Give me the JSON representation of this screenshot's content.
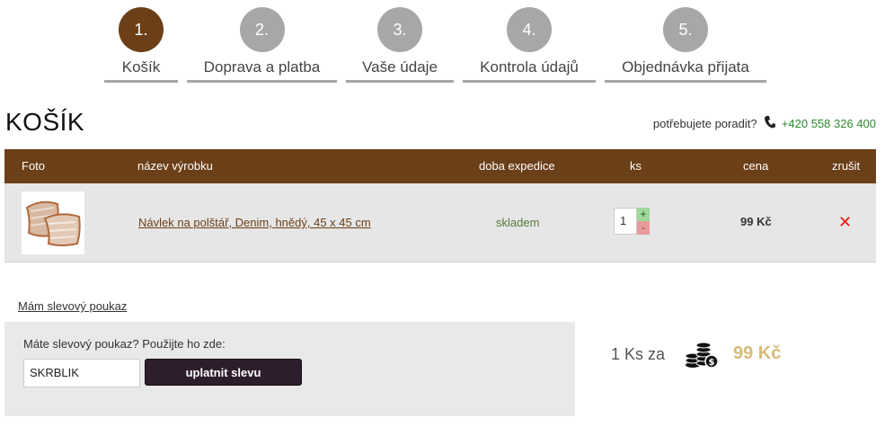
{
  "steps": [
    {
      "number": "1.",
      "label": "Košík",
      "active": true
    },
    {
      "number": "2.",
      "label": "Doprava a platba",
      "active": false
    },
    {
      "number": "3.",
      "label": "Vaše údaje",
      "active": false
    },
    {
      "number": "4.",
      "label": "Kontrola údajů",
      "active": false
    },
    {
      "number": "5.",
      "label": "Objednávka přijata",
      "active": false
    }
  ],
  "page_title": "KOŠÍK",
  "help": {
    "text": "potřebujete poradit?",
    "icon": "phone-icon",
    "phone": "+420 558 326 400"
  },
  "table": {
    "headers": {
      "photo": "Foto",
      "name": "název výrobku",
      "expedition": "doba expedice",
      "qty": "ks",
      "price": "cena",
      "remove": "zrušit"
    },
    "rows": [
      {
        "product_name": "Návlek na polštář, Denim, hnědý, 45 x 45 cm",
        "expedition": "skladem",
        "quantity": "1",
        "plus": "+",
        "minus": "-",
        "price": "99 Kč",
        "remove_icon": "✕"
      }
    ]
  },
  "discount": {
    "toggle_label": "Mám slevový poukaz",
    "prompt": "Máte slevový poukaz? Použijte ho zde:",
    "code_value": "SKRBLIK",
    "apply_label": "uplatnit slevu"
  },
  "summary": {
    "count_text": "1 Ks za",
    "icon": "coins-icon",
    "total": "99 Kč"
  },
  "colors": {
    "brand_brown": "#6b3f17",
    "step_inactive": "#a7a7a7",
    "phone_green": "#2f8a2f",
    "total_gold": "#d6bb7b",
    "remove_red": "#e11111"
  }
}
